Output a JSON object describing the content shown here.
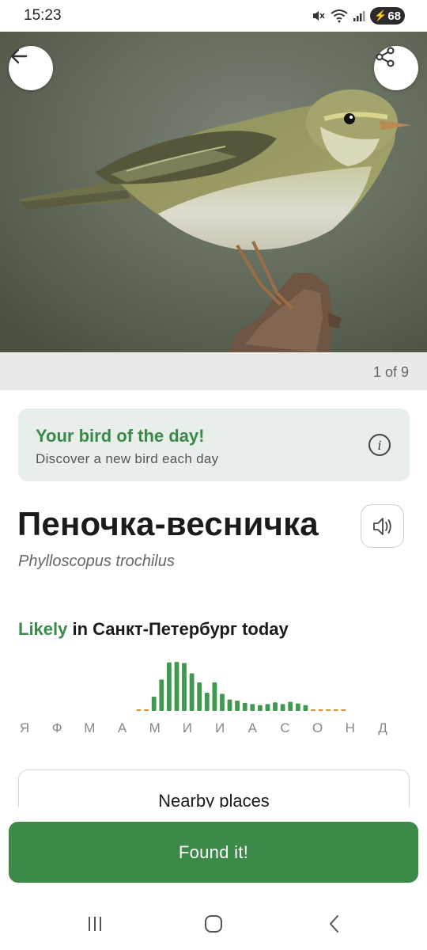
{
  "status_bar": {
    "time": "15:23",
    "battery": "68"
  },
  "icons": {
    "back": "arrow-left-icon",
    "share": "share-icon",
    "info": "info-icon",
    "sound": "speaker-icon",
    "nav_recents": "recents-icon",
    "nav_home": "home-icon",
    "nav_back": "chevron-left-icon"
  },
  "gallery": {
    "counter": "1 of 9"
  },
  "bird_of_day": {
    "title": "Your bird of the day!",
    "subtitle": "Discover a new bird each day"
  },
  "species": {
    "common_name": "Пеночка-весничка",
    "latin_name": "Phylloscopus trochilus"
  },
  "likelihood": {
    "word": "Likely",
    "rest": " in Санкт-Петербург today"
  },
  "chart_data": {
    "type": "bar",
    "categories": [
      "Я",
      "Ф",
      "М",
      "А",
      "М",
      "И",
      "И",
      "А",
      "С",
      "О",
      "Н",
      "Д"
    ],
    "values": [
      0,
      0,
      0,
      0,
      0,
      0,
      0,
      0,
      0,
      0,
      0,
      0,
      0,
      0,
      0,
      0.03,
      0.04,
      0.25,
      0.55,
      0.85,
      0.86,
      0.84,
      0.66,
      0.5,
      0.32,
      0.5,
      0.3,
      0.2,
      0.18,
      0.14,
      0.12,
      0.1,
      0.12,
      0.15,
      0.12,
      0.16,
      0.13,
      0.1,
      0.08,
      0.07,
      0.03,
      0.03,
      0.06,
      0,
      0,
      0,
      0,
      0
    ],
    "ylim": [
      0,
      1
    ],
    "colors": {
      "high": "#3f9a4f",
      "low": "#d3922e"
    }
  },
  "nearby": {
    "title": "Nearby places"
  },
  "actions": {
    "found": "Found it!"
  },
  "colors": {
    "accent": "#3b8a47",
    "accent_text": "#3a8a4a",
    "card_bg": "#e8eeea"
  }
}
